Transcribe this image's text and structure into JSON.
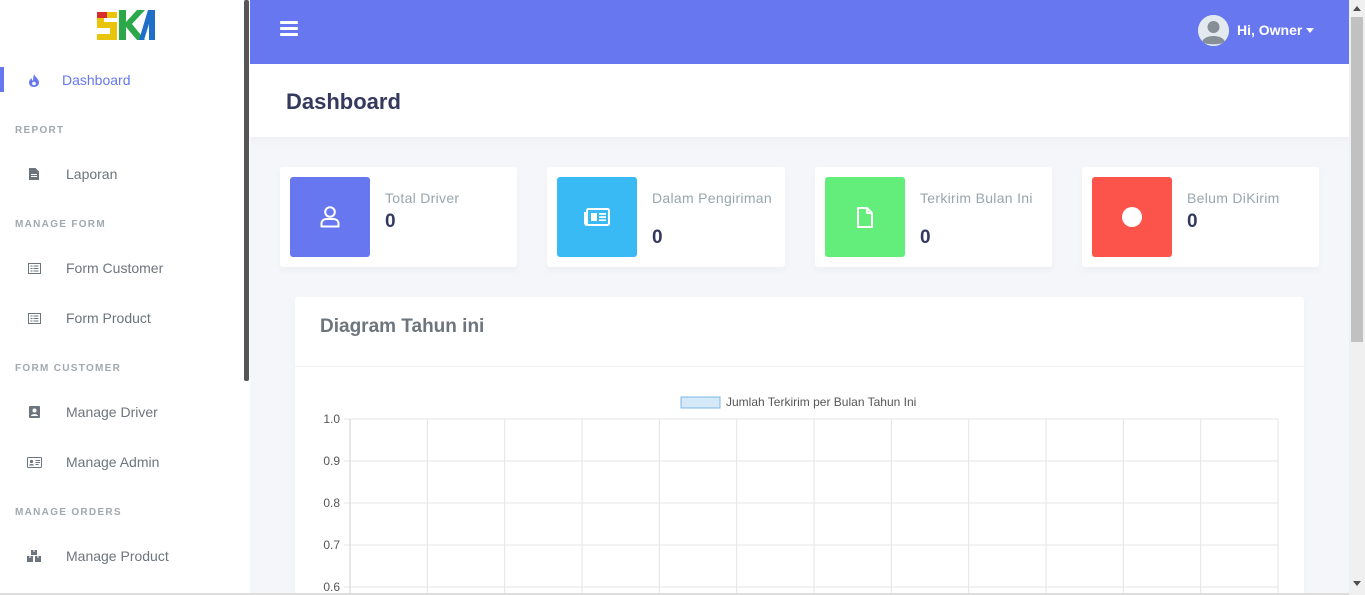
{
  "colors": {
    "primary": "#6777ef",
    "info": "#3abaf4",
    "success": "#63ed7a",
    "danger": "#fc544b"
  },
  "sidebar": {
    "brand_icon": "ska-logo",
    "items": [
      {
        "type": "item",
        "label": "Dashboard",
        "icon": "fire-icon",
        "active": true
      },
      {
        "type": "header",
        "label": "REPORT"
      },
      {
        "type": "item",
        "label": "Laporan",
        "icon": "file-icon"
      },
      {
        "type": "header",
        "label": "MANAGE FORM"
      },
      {
        "type": "item",
        "label": "Form Customer",
        "icon": "list-alt-icon"
      },
      {
        "type": "item",
        "label": "Form Product",
        "icon": "list-alt-icon"
      },
      {
        "type": "header",
        "label": "FORM CUSTOMER"
      },
      {
        "type": "item",
        "label": "Manage Driver",
        "icon": "address-book-icon"
      },
      {
        "type": "item",
        "label": "Manage Admin",
        "icon": "id-card-icon"
      },
      {
        "type": "header",
        "label": "MANAGE ORDERS"
      },
      {
        "type": "item",
        "label": "Manage Product",
        "icon": "boxes-icon"
      }
    ]
  },
  "navbar": {
    "menu_icon": "bars-icon",
    "user_greeting": "Hi, Owner",
    "avatar_icon": "user-avatar-icon"
  },
  "page": {
    "title": "Dashboard"
  },
  "stats": [
    {
      "title": "Total Driver",
      "value": "0",
      "icon": "user-icon",
      "color": "#6777ef"
    },
    {
      "title": "Dalam Pengiriman",
      "value": "0",
      "icon": "newspaper-icon",
      "color": "#3abaf4"
    },
    {
      "title": "Terkirim Bulan Ini",
      "value": "0",
      "icon": "file-icon",
      "color": "#63ed7a"
    },
    {
      "title": "Belum DiKirim",
      "value": "0",
      "icon": "circle-icon",
      "color": "#fc544b"
    }
  ],
  "chart_card": {
    "title": "Diagram Tahun ini"
  },
  "chart_data": {
    "type": "bar",
    "title": "",
    "legend": [
      "Jumlah Terkirim per Bulan Tahun Ini"
    ],
    "legend_position": "top",
    "series": [
      {
        "name": "Jumlah Terkirim per Bulan Tahun Ini",
        "values": []
      }
    ],
    "yticks": [
      "1.0",
      "0.9",
      "0.8",
      "0.7",
      "0.6"
    ],
    "ylim": [
      0,
      1
    ],
    "x_gridlines": 12,
    "grid": true
  }
}
